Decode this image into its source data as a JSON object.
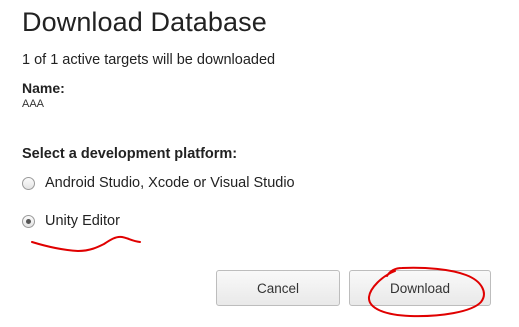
{
  "dialog": {
    "title": "Download Database",
    "subtitle": "1 of 1 active targets will be downloaded",
    "name_label": "Name:",
    "name_value": "AAA",
    "platform_label": "Select a development platform:",
    "options": [
      {
        "label": "Android Studio, Xcode or Visual Studio",
        "selected": false
      },
      {
        "label": "Unity Editor",
        "selected": true
      }
    ],
    "buttons": {
      "cancel": "Cancel",
      "download": "Download"
    }
  },
  "annotation_color": "#e00000"
}
